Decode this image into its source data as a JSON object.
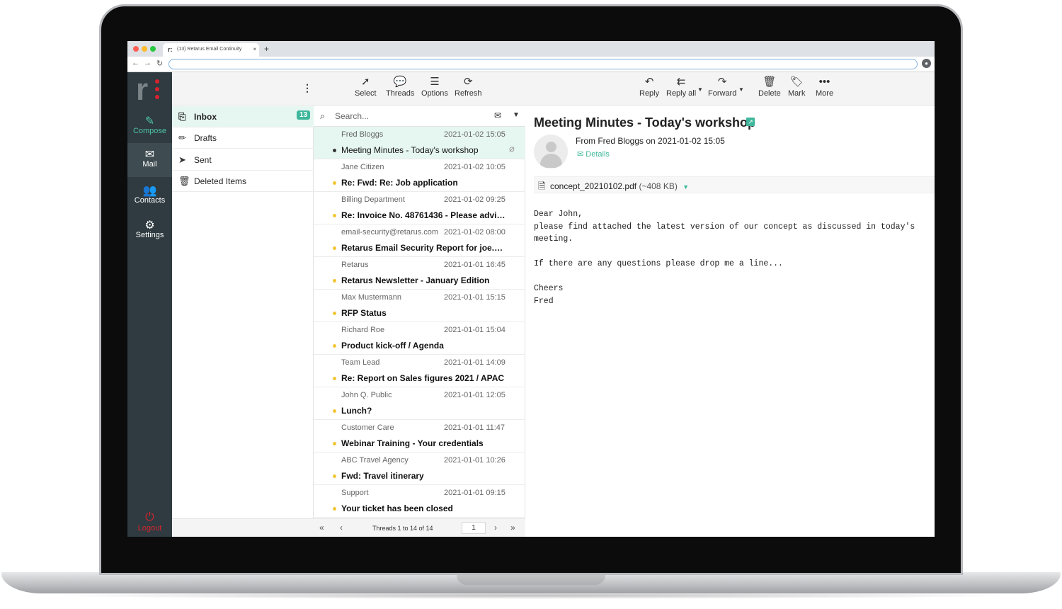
{
  "browser": {
    "tab_title": "(13) Retarus Email Continuity",
    "tab_logo": "r:",
    "close": "×",
    "new_tab": "+",
    "nav": {
      "back": "←",
      "forward": "→",
      "reload": "↻"
    }
  },
  "rail": {
    "compose": "Compose",
    "mail": "Mail",
    "contacts": "Contacts",
    "settings": "Settings",
    "logout": "Logout"
  },
  "folders": [
    {
      "label": "Inbox",
      "count": "13",
      "icon": "inbox-icon"
    },
    {
      "label": "Drafts",
      "icon": "pencil-icon"
    },
    {
      "label": "Sent",
      "icon": "send-icon"
    },
    {
      "label": "Deleted Items",
      "icon": "trash-icon"
    }
  ],
  "list_toolbar": {
    "select": "Select",
    "threads": "Threads",
    "options": "Options",
    "refresh": "Refresh"
  },
  "search": {
    "placeholder": "Search..."
  },
  "messages": [
    {
      "from": "Fred Bloggs",
      "date": "2021-01-02 15:05",
      "subject": "Meeting Minutes - Today's workshop"
    },
    {
      "from": "Jane Citizen",
      "date": "2021-01-02 10:05",
      "subject": "Re: Fwd: Re: Job application"
    },
    {
      "from": "Billing Department",
      "date": "2021-01-02 09:25",
      "subject": "Re: Invoice No. 48761436 - Please advise"
    },
    {
      "from": "email-security@retarus.com",
      "date": "2021-01-02 08:00",
      "subject": "Retarus Email Security Report for joe.do..."
    },
    {
      "from": "Retarus",
      "date": "2021-01-01 16:45",
      "subject": "Retarus Newsletter - January Edition"
    },
    {
      "from": "Max Mustermann",
      "date": "2021-01-01 15:15",
      "subject": "RFP Status"
    },
    {
      "from": "Richard Roe",
      "date": "2021-01-01 15:04",
      "subject": "Product kick-off / Agenda"
    },
    {
      "from": "Team Lead",
      "date": "2021-01-01 14:09",
      "subject": "Re: Report on Sales figures 2021 / APAC"
    },
    {
      "from": "John Q. Public",
      "date": "2021-01-01 12:05",
      "subject": "Lunch?"
    },
    {
      "from": "Customer Care",
      "date": "2021-01-01 11:47",
      "subject": "Webinar Training - Your credentials"
    },
    {
      "from": "ABC Travel Agency",
      "date": "2021-01-01 10:26",
      "subject": "Fwd: Travel itinerary"
    },
    {
      "from": "Support",
      "date": "2021-01-01 09:15",
      "subject": "Your ticket has been closed"
    }
  ],
  "pagination": {
    "info": "Threads 1 to 14 of 14",
    "page": "1"
  },
  "reader_toolbar": {
    "reply": "Reply",
    "reply_all": "Reply all",
    "forward": "Forward",
    "delete": "Delete",
    "mark": "Mark",
    "more": "More"
  },
  "email": {
    "title": "Meeting Minutes - Today's workshop",
    "from_line": "From Fred Bloggs on 2021-01-02 15:05",
    "details": "Details",
    "attachment_name": "concept_20210102.pdf",
    "attachment_size": "(~408 KB)",
    "body": "Dear John,\nplease find attached the latest version of our concept as discussed in today's\nmeeting.\n\nIf there are any questions please drop me a line...\n\nCheers\nFred"
  },
  "colors": {
    "accent": "#3fb79c",
    "rail": "#2f3b40",
    "unread_dot": "#f3c534",
    "logout": "#d9232e"
  }
}
